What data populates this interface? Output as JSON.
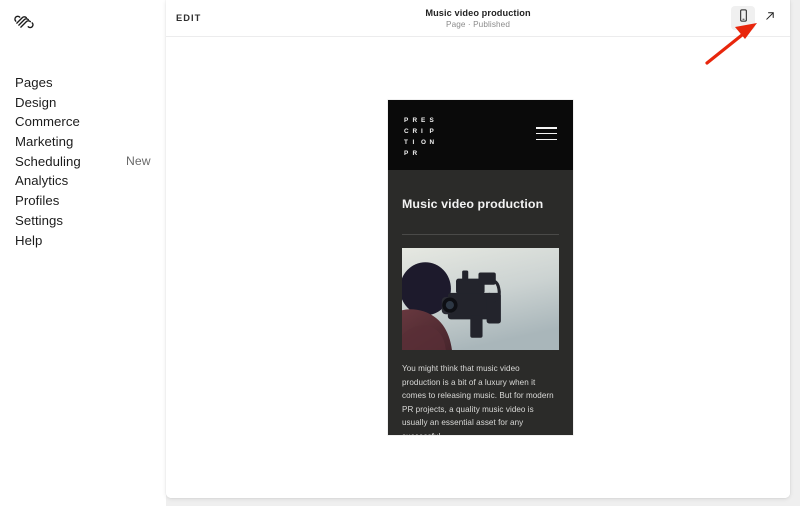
{
  "sidebar": {
    "logo_icon": "squarespace-logo-icon",
    "items": [
      {
        "label": "Pages",
        "badge": ""
      },
      {
        "label": "Design",
        "badge": ""
      },
      {
        "label": "Commerce",
        "badge": ""
      },
      {
        "label": "Marketing",
        "badge": ""
      },
      {
        "label": "Scheduling",
        "badge": "New"
      },
      {
        "label": "Analytics",
        "badge": ""
      },
      {
        "label": "Profiles",
        "badge": ""
      },
      {
        "label": "Settings",
        "badge": ""
      },
      {
        "label": "Help",
        "badge": ""
      }
    ]
  },
  "topbar": {
    "edit_label": "EDIT",
    "page_title": "Music video production",
    "page_status": "Page · Published",
    "mobile_view_icon": "mobile-device-icon",
    "open_in_new_icon": "external-link-icon"
  },
  "preview": {
    "site_logo_lines": [
      "P",
      "R",
      "E",
      "S",
      "C",
      "R",
      "I",
      "P",
      "T",
      "I",
      "O",
      "N",
      "P",
      "R"
    ],
    "site_logo_text": "PRESCRIPTION PR",
    "menu_icon": "hamburger-menu-icon",
    "heading": "Music video production",
    "image_alt": "videographer-filming-with-camera",
    "body_text": "You might think that music video production is a bit of a luxury when it comes to releasing music. But for modern PR projects, a quality music video is usually an essential asset for any successful"
  },
  "annotation": {
    "arrow_icon": "red-pointer-arrow-icon",
    "color": "#e8260c"
  },
  "colors": {
    "app_background": "#ffffff",
    "canvas_background": "#efefef",
    "preview_body": "#2b2b29",
    "preview_header": "#0a0a0a",
    "active_button": "#f0f0f0"
  }
}
